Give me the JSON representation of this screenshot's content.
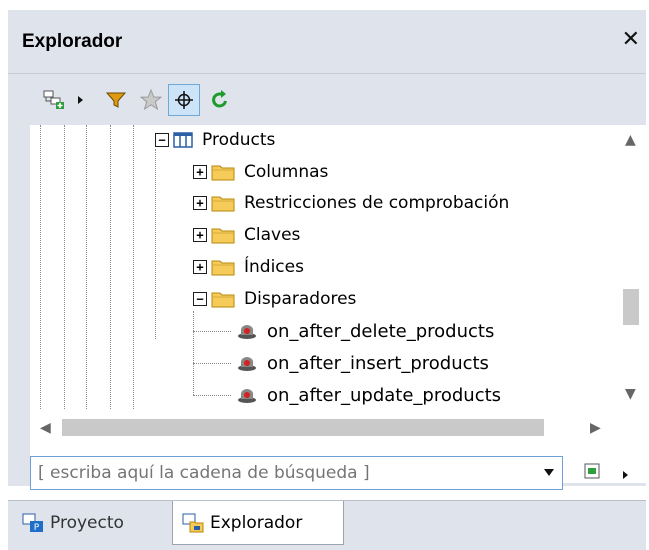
{
  "window": {
    "title": "Explorador"
  },
  "toolbar": {
    "buttons": [
      {
        "icon": "add-object-icon"
      },
      {
        "icon": "dropdown-arrow-icon"
      },
      {
        "icon": "filter-icon"
      },
      {
        "icon": "favorites-star-icon"
      },
      {
        "icon": "sync-selection-icon"
      },
      {
        "icon": "refresh-icon"
      }
    ]
  },
  "tree": {
    "nodes": [
      {
        "label": "Products",
        "icon": "table-icon",
        "expander": "−"
      },
      {
        "label": "Columnas",
        "icon": "folder-icon",
        "expander": "+"
      },
      {
        "label": "Restricciones de comprobación",
        "icon": "folder-icon",
        "expander": "+"
      },
      {
        "label": "Claves",
        "icon": "folder-icon",
        "expander": "+"
      },
      {
        "label": "Índices",
        "icon": "folder-icon",
        "expander": "+"
      },
      {
        "label": "Disparadores",
        "icon": "folder-icon",
        "expander": "−"
      },
      {
        "label": "on_after_delete_products",
        "icon": "trigger-icon"
      },
      {
        "label": "on_after_insert_products",
        "icon": "trigger-icon"
      },
      {
        "label": "on_after_update_products",
        "icon": "trigger-icon"
      }
    ]
  },
  "search": {
    "placeholder": "[ escriba aquí la cadena de búsqueda ]"
  },
  "tabs": [
    {
      "label": "Proyecto",
      "icon": "project-icon",
      "active": false
    },
    {
      "label": "Explorador",
      "icon": "explorer-icon",
      "active": true
    }
  ],
  "colors": {
    "panel": "#dfe4ec",
    "folder": "#f5cc5a",
    "accent": "#6ea0d6",
    "refresh": "#1c9c2c"
  }
}
